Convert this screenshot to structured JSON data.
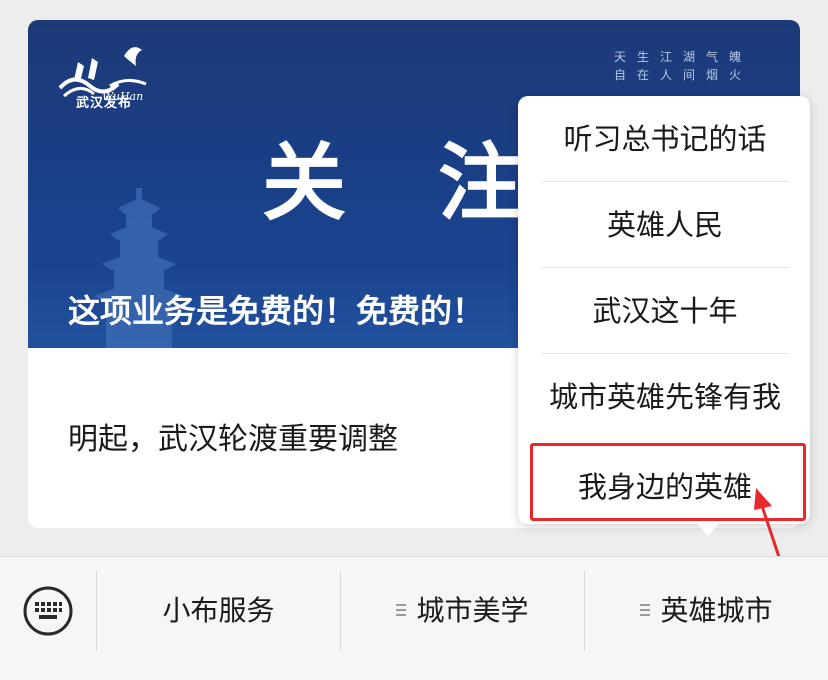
{
  "banner": {
    "logo_text": "武汉发布",
    "slogan_line1": "天生江湖气魄",
    "slogan_line2": "自在人间烟火",
    "big_title": "关注",
    "subtitle": "这项业务是免费的！免费的！"
  },
  "article": {
    "title": "明起，武汉轮渡重要调整"
  },
  "popup_menu": {
    "items": [
      {
        "label": "听习总书记的话"
      },
      {
        "label": "英雄人民"
      },
      {
        "label": "武汉这十年"
      },
      {
        "label": "城市英雄先锋有我"
      },
      {
        "label": "我身边的英雄"
      }
    ],
    "highlighted_index": 4
  },
  "bottom_bar": {
    "keyboard_icon": "keyboard-icon",
    "menus": [
      {
        "label": "小布服务",
        "has_submenu": false
      },
      {
        "label": "城市美学",
        "has_submenu": true
      },
      {
        "label": "英雄城市",
        "has_submenu": true
      }
    ]
  },
  "colors": {
    "highlight": "#e8282b",
    "banner": "#1d3a78",
    "background": "#ededed"
  }
}
